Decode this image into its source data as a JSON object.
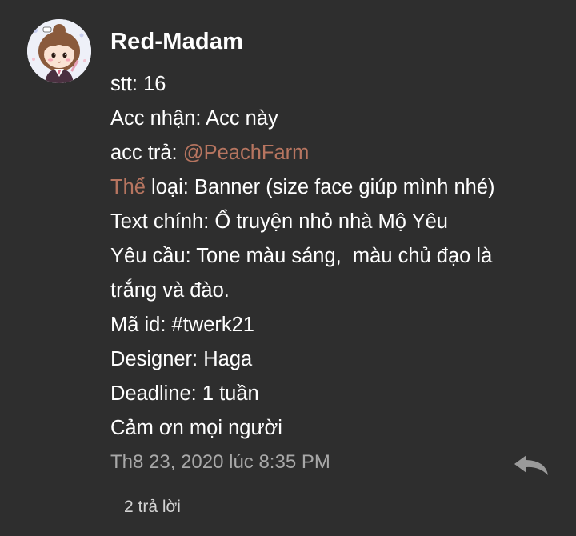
{
  "author": {
    "name": "Red-Madam",
    "avatar_icon": "chibi-girl-avatar-icon"
  },
  "comment": {
    "line1": "stt: 16",
    "line2": "Acc nhận: Acc này",
    "line3_label": "acc trả: ",
    "line3_mention": "@PeachFarm",
    "line4_mention": "Thể",
    "line4_rest": " loại: Banner (size face giúp mình nhé)",
    "line5": "Text chính: Ổ truyện nhỏ nhà Mộ Yêu",
    "line6": "Yêu cầu: Tone màu sáng,  màu chủ đạo là",
    "line7": "trắng và đào.",
    "line8": "Mã id: #twerk21",
    "line9": "Designer: Haga",
    "line10": "Deadline: 1 tuần",
    "line11": "Cảm ơn mọi người"
  },
  "meta": {
    "timestamp": "Th8 23, 2020 lúc 8:35 PM",
    "reply_icon": "reply-arrow-icon",
    "reply_count": "2 trả lời"
  },
  "colors": {
    "background": "#2e2e2e",
    "mention": "#b77560",
    "muted": "#a8a8a8"
  }
}
